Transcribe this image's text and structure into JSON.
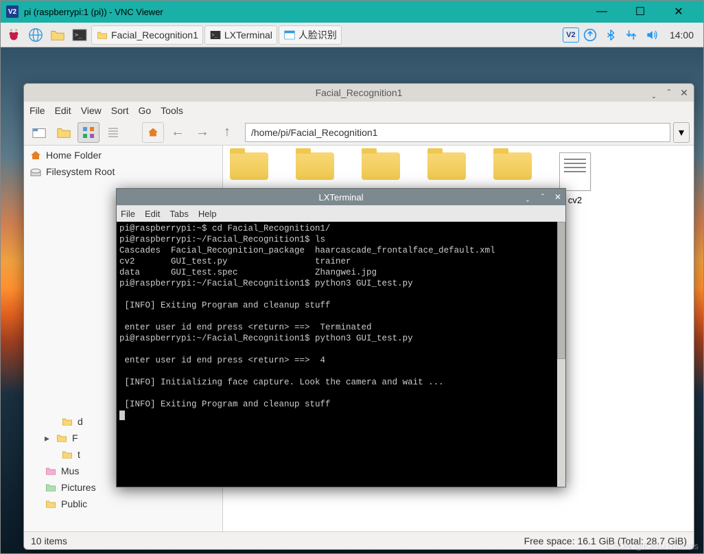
{
  "vnc": {
    "logo_text": "V2",
    "title": "pi (raspberrypi:1 (pi)) - VNC Viewer",
    "min": "—",
    "max": "☐",
    "close": "✕"
  },
  "taskbar": {
    "tasks": [
      {
        "label": "Facial_Recognition1"
      },
      {
        "label": "LXTerminal"
      },
      {
        "label": "人脸识别"
      }
    ],
    "vnc_badge": "V2",
    "clock": "14:00"
  },
  "fm": {
    "title": "Facial_Recognition1",
    "menu": [
      "File",
      "Edit",
      "View",
      "Sort",
      "Go",
      "Tools"
    ],
    "path": "/home/pi/Facial_Recognition1",
    "side": {
      "home": "Home Folder",
      "fsroot": "Filesystem Root",
      "tree": [
        {
          "label": "d",
          "truncated": true
        },
        {
          "label": "F",
          "expandable": true,
          "truncated": true
        },
        {
          "label": "t",
          "truncated": true
        },
        {
          "label": "Mus",
          "truncated": true
        },
        {
          "label": "Pictures"
        },
        {
          "label": "Public"
        }
      ]
    },
    "file_label": "cv2",
    "status_left": "10 items",
    "status_right": "Free space: 16.1 GiB (Total: 28.7 GiB)"
  },
  "term": {
    "title": "LXTerminal",
    "menu": [
      "File",
      "Edit",
      "Tabs",
      "Help"
    ],
    "lines": [
      "pi@raspberrypi:~$ cd Facial_Recognition1/",
      "pi@raspberrypi:~/Facial_Recognition1$ ls",
      "Cascades  Facial_Recognition_package  haarcascade_frontalface_default.xml",
      "cv2       GUI_test.py                 trainer",
      "data      GUI_test.spec               Zhangwei.jpg",
      "pi@raspberrypi:~/Facial_Recognition1$ python3 GUI_test.py",
      "",
      " [INFO] Exiting Program and cleanup stuff",
      "",
      " enter user id end press <return> ==>  Terminated",
      "pi@raspberrypi:~/Facial_Recognition1$ python3 GUI_test.py",
      "",
      " enter user id end press <return> ==>  4",
      "",
      " [INFO] Initializing face capture. Look the camera and wait ...",
      "",
      " [INFO] Exiting Program and cleanup stuff"
    ]
  },
  "watermark": "CSDN @FJNUThomas"
}
